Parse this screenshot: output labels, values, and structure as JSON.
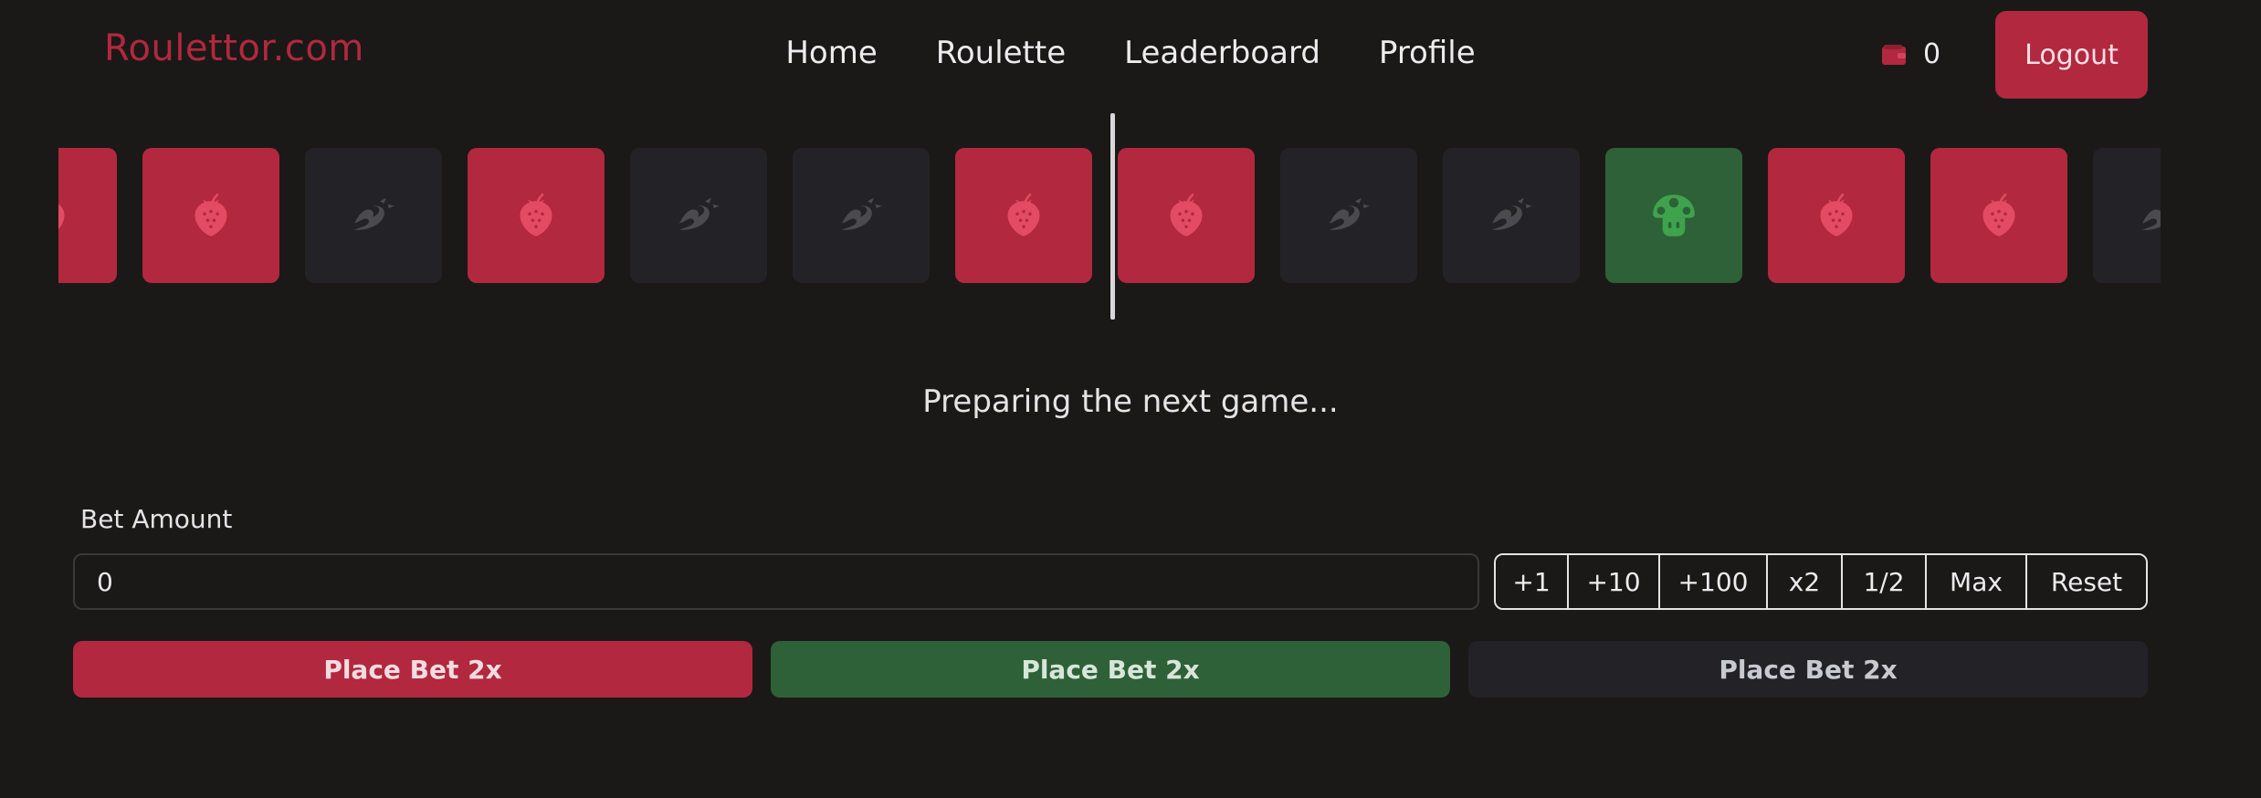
{
  "header": {
    "brand": "Roulettor.com",
    "nav": [
      "Home",
      "Roulette",
      "Leaderboard",
      "Profile"
    ],
    "wallet_icon": "wallet-icon",
    "balance": "0",
    "logout_label": "Logout"
  },
  "roulette": {
    "tiles": [
      "red",
      "red",
      "dark",
      "red",
      "dark",
      "dark",
      "red",
      "red",
      "dark",
      "dark",
      "green",
      "red",
      "red",
      "dark",
      "dark"
    ],
    "icons": {
      "red": "strawberry-icon",
      "dark": "dragon-icon",
      "green": "mushroom-icon"
    },
    "colors": {
      "red": "#b2283e",
      "dark": "#232327",
      "green": "#2e6138"
    },
    "status": "Preparing the next game..."
  },
  "bet": {
    "label": "Bet Amount",
    "value": "0",
    "quick_buttons": [
      "+1",
      "+10",
      "+100",
      "x2",
      "1/2",
      "Max",
      "Reset"
    ],
    "place_buttons": [
      {
        "label": "Place Bet 2x",
        "color": "red"
      },
      {
        "label": "Place Bet 2x",
        "color": "green"
      },
      {
        "label": "Place Bet 2x",
        "color": "dark"
      }
    ]
  }
}
